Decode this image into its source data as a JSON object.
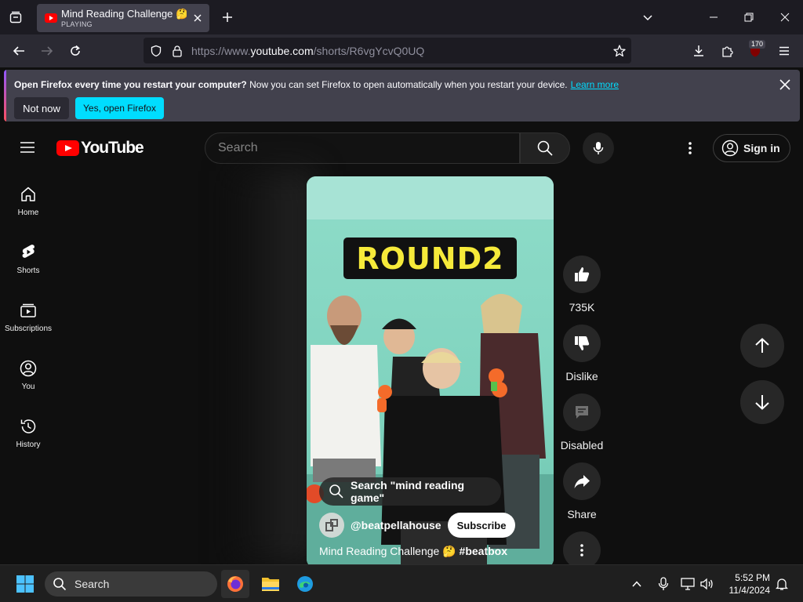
{
  "browser": {
    "tab": {
      "title": "Mind Reading Challenge 🤔 #beatbox",
      "status": "PLAYING"
    },
    "url": {
      "prefix": "https://www.",
      "host": "youtube.com",
      "path": "/shorts/R6vgYcvQ0UQ"
    },
    "extension_badge": "170",
    "notification": {
      "title": "Open Firefox every time you restart your computer?",
      "body": "Now you can set Firefox to open automatically when you restart your device.",
      "link": "Learn more",
      "not_now": "Not now",
      "yes": "Yes, open Firefox"
    }
  },
  "youtube": {
    "logo_text": "YouTube",
    "search_placeholder": "Search",
    "sign_in": "Sign in",
    "sidebar": [
      {
        "label": "Home",
        "icon": "home-icon"
      },
      {
        "label": "Shorts",
        "icon": "shorts-icon"
      },
      {
        "label": "Subscriptions",
        "icon": "subscriptions-icon"
      },
      {
        "label": "You",
        "icon": "you-icon"
      },
      {
        "label": "History",
        "icon": "history-icon"
      }
    ],
    "short": {
      "overlay_text": "ROUND2",
      "search_chip": "Search \"mind reading game\"",
      "channel": "@beatpellahouse",
      "subscribe": "Subscribe",
      "title": "Mind Reading Challenge 🤔",
      "hashtag": "#beatbox"
    },
    "actions": {
      "like": "735K",
      "dislike": "Dislike",
      "comments": "Disabled",
      "share": "Share"
    }
  },
  "taskbar": {
    "search": "Search",
    "time": "5:52 PM",
    "date": "11/4/2024"
  }
}
